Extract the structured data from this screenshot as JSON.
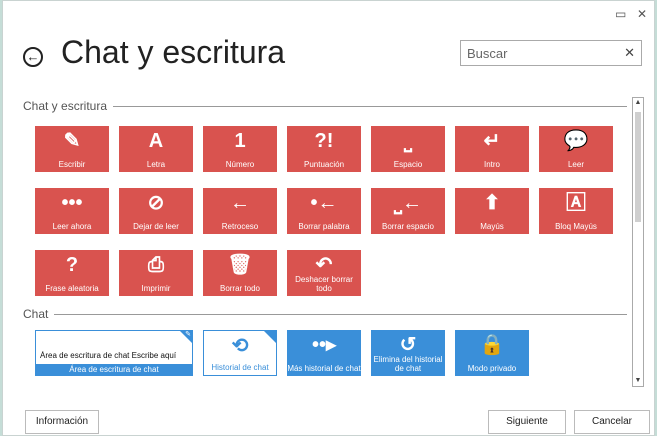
{
  "window": {
    "minimize_glyph": "▭",
    "close_glyph": "✕"
  },
  "header": {
    "back_glyph": "←",
    "title": "Chat y escritura",
    "search_placeholder": "Buscar",
    "clear_glyph": "✕"
  },
  "sections": [
    {
      "title": "Chat y escritura"
    },
    {
      "title": "Chat"
    }
  ],
  "writing_tiles": [
    {
      "label": "Escribir",
      "icon": "✎",
      "icon_name": "feather-icon"
    },
    {
      "label": "Letra",
      "icon": "A",
      "icon_name": "letter-icon"
    },
    {
      "label": "Número",
      "icon": "1",
      "icon_name": "number-icon"
    },
    {
      "label": "Puntuación",
      "icon": "?!",
      "icon_name": "punctuation-icon"
    },
    {
      "label": "Espacio",
      "icon": "⎵",
      "icon_name": "space-icon"
    },
    {
      "label": "Intro",
      "icon": "↵",
      "icon_name": "enter-icon"
    },
    {
      "label": "Leer",
      "icon": "💬",
      "icon_name": "speech-bubble-icon"
    },
    {
      "label": "Leer ahora",
      "icon": "•••",
      "icon_name": "speech-dots-icon"
    },
    {
      "label": "Dejar de leer",
      "icon": "⊘",
      "icon_name": "stop-speech-icon"
    },
    {
      "label": "Retroceso",
      "icon": "←",
      "icon_name": "backspace-arrow-icon"
    },
    {
      "label": "Borrar palabra",
      "icon": "•←",
      "icon_name": "delete-word-icon"
    },
    {
      "label": "Borrar espacio",
      "icon": "⎵←",
      "icon_name": "delete-space-icon"
    },
    {
      "label": "Mayús",
      "icon": "⬆",
      "icon_name": "shift-icon"
    },
    {
      "label": "Bloq Mayús",
      "icon": "🄰",
      "icon_name": "caps-lock-icon"
    },
    {
      "label": "Frase aleatoria",
      "icon": "?",
      "icon_name": "question-icon"
    },
    {
      "label": "Imprimir",
      "icon": "⎙",
      "icon_name": "printer-icon"
    },
    {
      "label": "Borrar todo",
      "icon": "🗑",
      "icon_name": "trash-icon"
    },
    {
      "label": "Deshacer borrar todo",
      "icon": "↶",
      "icon_name": "undo-trash-icon"
    }
  ],
  "chat": {
    "wide_tile": {
      "content_text": "Área de escritura de chat    Escribe aquí",
      "label": "Área de escritura de chat"
    },
    "tiles": [
      {
        "label": "Historial de chat",
        "icon": "⟲",
        "icon_name": "history-icon",
        "style": "outline"
      },
      {
        "label": "Más historial de chat",
        "icon": "••▸",
        "icon_name": "more-history-icon",
        "style": "blue"
      },
      {
        "label": "Elimina del historial de chat",
        "icon": "↺",
        "icon_name": "delete-history-icon",
        "style": "blue"
      },
      {
        "label": "Modo privado",
        "icon": "🔒",
        "icon_name": "lock-icon",
        "style": "blue"
      }
    ]
  },
  "footer": {
    "info_button": "Información",
    "next_button": "Siguiente",
    "cancel_button": "Cancelar"
  },
  "colors": {
    "red_tile": "#d9534f",
    "blue_tile": "#3a8fd9",
    "background": "#c5ddd7"
  }
}
